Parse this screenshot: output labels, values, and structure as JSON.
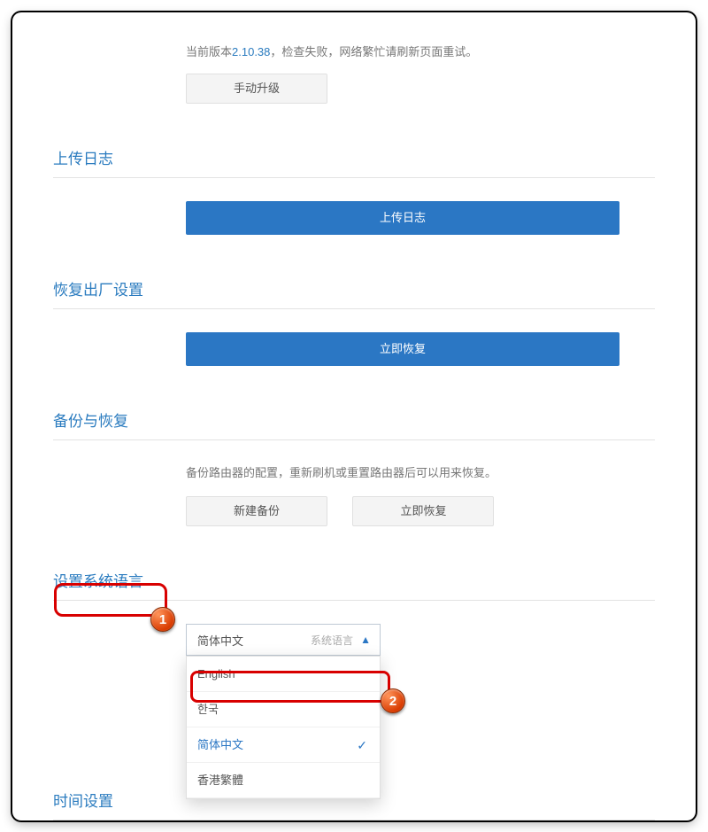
{
  "version": {
    "prefix": "当前版本",
    "number": "2.10.38",
    "suffix": "，检查失败，网络繁忙请刷新页面重试。",
    "manual_upgrade": "手动升级"
  },
  "upload_log": {
    "title": "上传日志",
    "button": "上传日志"
  },
  "factory_reset": {
    "title": "恢复出厂设置",
    "button": "立即恢复"
  },
  "backup": {
    "title": "备份与恢复",
    "desc": "备份路由器的配置，重新刷机或重置路由器后可以用来恢复。",
    "new_backup": "新建备份",
    "restore": "立即恢复"
  },
  "language": {
    "title": "设置系统语言",
    "selected": "简体中文",
    "hint": "系统语言",
    "options": [
      "English",
      "한국",
      "简体中文",
      "香港繁體"
    ],
    "active_index": 2
  },
  "time": {
    "title": "时间设置"
  },
  "annotations": {
    "badge1": "1",
    "badge2": "2"
  }
}
